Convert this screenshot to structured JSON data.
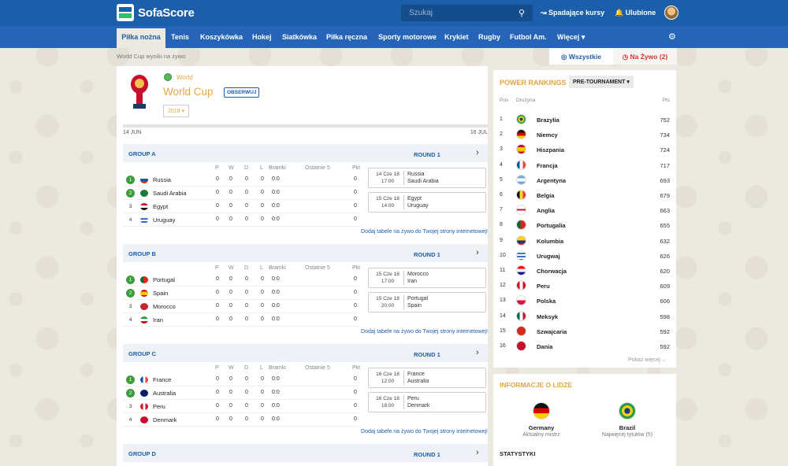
{
  "header": {
    "logo": "SofaScore",
    "search_placeholder": "Szukaj",
    "trending": "Spadające kursy",
    "favorites": "Ulubione"
  },
  "nav": {
    "items": [
      "Piłka nożna",
      "Tenis",
      "Koszykówka",
      "Hokej",
      "Siatkówka",
      "Piłka ręczna",
      "Sporty motorowe",
      "Krykiet",
      "Rugby",
      "Futbol Am.",
      "Więcej ▾"
    ]
  },
  "breadcrumb": "World Cup wyniki na żywo",
  "tabs": {
    "all": "Wszystkie",
    "live": "Na Żywo (2)"
  },
  "tournament": {
    "category": "World",
    "title": "World Cup",
    "follow": "OBSERWUJ",
    "year": "2018 ▾",
    "start": "14 JUN",
    "end": "16 JUL"
  },
  "cols": {
    "p": "P",
    "w": "W",
    "d": "D",
    "l": "L",
    "bramki": "Bramki",
    "ostatnie": "Ostatnie 5",
    "pkt": "Pkt"
  },
  "add_link": "Dodaj tabele na żywo do Twojej strony internetowej!",
  "groups": [
    {
      "name": "GROUP A",
      "round": "ROUND 1",
      "teams": [
        {
          "pos": "1",
          "name": "Russia",
          "p": "0",
          "w": "0",
          "d": "0",
          "l": "0",
          "g": "0:0",
          "pkt": "0"
        },
        {
          "pos": "2",
          "name": "Saudi Arabia",
          "p": "0",
          "w": "0",
          "d": "0",
          "l": "0",
          "g": "0:0",
          "pkt": "0"
        },
        {
          "pos": "3",
          "name": "Egypt",
          "p": "0",
          "w": "0",
          "d": "0",
          "l": "0",
          "g": "0:0",
          "pkt": "0"
        },
        {
          "pos": "4",
          "name": "Uruguay",
          "p": "0",
          "w": "0",
          "d": "0",
          "l": "0",
          "g": "0:0",
          "pkt": "0"
        }
      ],
      "matches": [
        {
          "date": "14 Cze 18",
          "time": "17:00",
          "home": "Russia",
          "away": "Saudi Arabia"
        },
        {
          "date": "15 Cze 18",
          "time": "14:00",
          "home": "Egypt",
          "away": "Uruguay"
        }
      ]
    },
    {
      "name": "GROUP B",
      "round": "ROUND 1",
      "teams": [
        {
          "pos": "1",
          "name": "Portugal",
          "p": "0",
          "w": "0",
          "d": "0",
          "l": "0",
          "g": "0:0",
          "pkt": "0"
        },
        {
          "pos": "2",
          "name": "Spain",
          "p": "0",
          "w": "0",
          "d": "0",
          "l": "0",
          "g": "0:0",
          "pkt": "0"
        },
        {
          "pos": "3",
          "name": "Morocco",
          "p": "0",
          "w": "0",
          "d": "0",
          "l": "0",
          "g": "0:0",
          "pkt": "0"
        },
        {
          "pos": "4",
          "name": "Iran",
          "p": "0",
          "w": "0",
          "d": "0",
          "l": "0",
          "g": "0:0",
          "pkt": "0"
        }
      ],
      "matches": [
        {
          "date": "15 Cze 18",
          "time": "17:00",
          "home": "Morocco",
          "away": "Iran"
        },
        {
          "date": "15 Cze 18",
          "time": "20:00",
          "home": "Portugal",
          "away": "Spain"
        }
      ]
    },
    {
      "name": "GROUP C",
      "round": "ROUND 1",
      "teams": [
        {
          "pos": "1",
          "name": "France",
          "p": "0",
          "w": "0",
          "d": "0",
          "l": "0",
          "g": "0:0",
          "pkt": "0"
        },
        {
          "pos": "2",
          "name": "Australia",
          "p": "0",
          "w": "0",
          "d": "0",
          "l": "0",
          "g": "0:0",
          "pkt": "0"
        },
        {
          "pos": "3",
          "name": "Peru",
          "p": "0",
          "w": "0",
          "d": "0",
          "l": "0",
          "g": "0:0",
          "pkt": "0"
        },
        {
          "pos": "4",
          "name": "Denmark",
          "p": "0",
          "w": "0",
          "d": "0",
          "l": "0",
          "g": "0:0",
          "pkt": "0"
        }
      ],
      "matches": [
        {
          "date": "16 Cze 18",
          "time": "12:00",
          "home": "France",
          "away": "Australia"
        },
        {
          "date": "16 Cze 18",
          "time": "18:00",
          "home": "Peru",
          "away": "Denmark"
        }
      ]
    },
    {
      "name": "GROUP D",
      "round": "ROUND 1",
      "teams": [],
      "matches": []
    }
  ],
  "rankings": {
    "title": "POWER RANKINGS",
    "mode": "PRE-TOURNAMENT ▾",
    "col_pos": "Pos",
    "col_team": "Drużyna",
    "col_pts": "Pts",
    "more": "Pokaż więcej ⌵",
    "rows": [
      {
        "pos": "1",
        "name": "Brazylia",
        "pts": "752"
      },
      {
        "pos": "2",
        "name": "Niemcy",
        "pts": "734"
      },
      {
        "pos": "3",
        "name": "Hiszpania",
        "pts": "724"
      },
      {
        "pos": "4",
        "name": "Francja",
        "pts": "717"
      },
      {
        "pos": "5",
        "name": "Argentyna",
        "pts": "693"
      },
      {
        "pos": "6",
        "name": "Belgia",
        "pts": "679"
      },
      {
        "pos": "7",
        "name": "Anglia",
        "pts": "663"
      },
      {
        "pos": "8",
        "name": "Portugalia",
        "pts": "655"
      },
      {
        "pos": "9",
        "name": "Kolumbia",
        "pts": "632"
      },
      {
        "pos": "10",
        "name": "Urugwaj",
        "pts": "626"
      },
      {
        "pos": "11",
        "name": "Chorwacja",
        "pts": "620"
      },
      {
        "pos": "12",
        "name": "Peru",
        "pts": "609"
      },
      {
        "pos": "13",
        "name": "Polska",
        "pts": "606"
      },
      {
        "pos": "14",
        "name": "Meksyk",
        "pts": "598"
      },
      {
        "pos": "15",
        "name": "Szwajcaria",
        "pts": "592"
      },
      {
        "pos": "16",
        "name": "Dania",
        "pts": "592"
      }
    ]
  },
  "league_info": {
    "title": "INFORMACJE O LIDZE",
    "champ_name": "Germany",
    "champ_label": "Aktualny mistrz",
    "most_name": "Brazil",
    "most_label": "Najwięcej tytułów (5)",
    "stats": "STATYSTYKI"
  }
}
